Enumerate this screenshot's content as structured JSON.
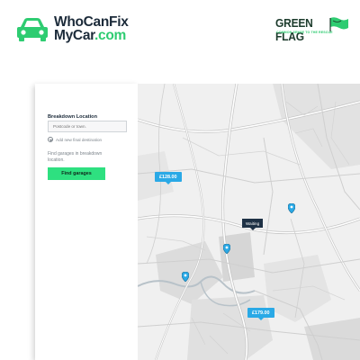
{
  "header": {
    "logo_line1": "WhoCanFix",
    "logo_line2_main": "MyCar",
    "logo_line2_suffix": ".com",
    "partner_title": "GREEN FLAG",
    "partner_tagline": "COMMON SENSE TO THE RESCUE"
  },
  "panel": {
    "field_label": "Breakdown Location",
    "field_placeholder": "Postcode or town.",
    "add_destination": "Add new final destination",
    "hint": "Find garages in breakdown location.",
    "find_button": "Find garages"
  },
  "map": {
    "price_tags": [
      "£128.00",
      "£179.00"
    ],
    "waiting_label": "Waiting"
  },
  "colors": {
    "brand_green": "#2ecc71",
    "button_green": "#2ee080",
    "price_blue": "#2aa9e6",
    "dark_navy": "#1c2b3a"
  }
}
